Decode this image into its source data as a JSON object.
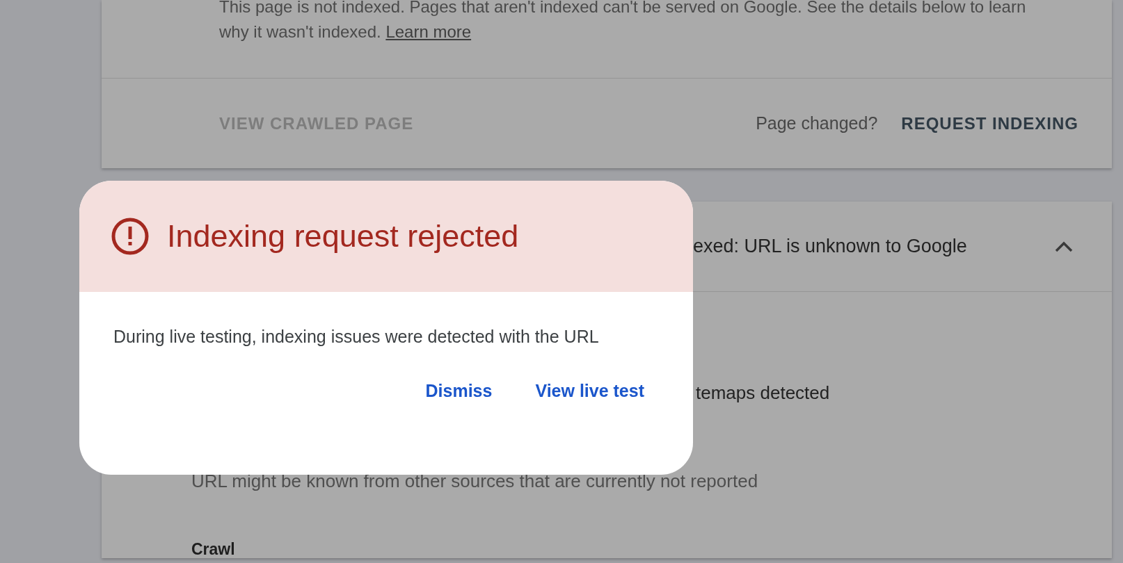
{
  "status_card": {
    "description": "This page is not indexed. Pages that aren't indexed can't be served on Google. See the details below to learn why it wasn't indexed.",
    "learn_more_link": "Learn more",
    "view_crawled_page": {
      "label": "VIEW CRAWLED PAGE",
      "disabled": true
    },
    "page_changed": "Page changed?",
    "request_indexing": {
      "label": "REQUEST INDEXING",
      "disabled": false
    }
  },
  "coverage_card": {
    "heading": "exed: URL is unknown to Google",
    "expanded": true,
    "sitemaps_text": "temaps detected",
    "referring_note": "URL might be known from other sources that are currently not reported",
    "crawl_heading": "Crawl"
  },
  "dialog": {
    "title": "Indexing request rejected",
    "message": "During live testing, indexing issues were detected with the URL",
    "buttons": [
      {
        "label": "Dismiss"
      },
      {
        "label": "View live test"
      }
    ]
  }
}
